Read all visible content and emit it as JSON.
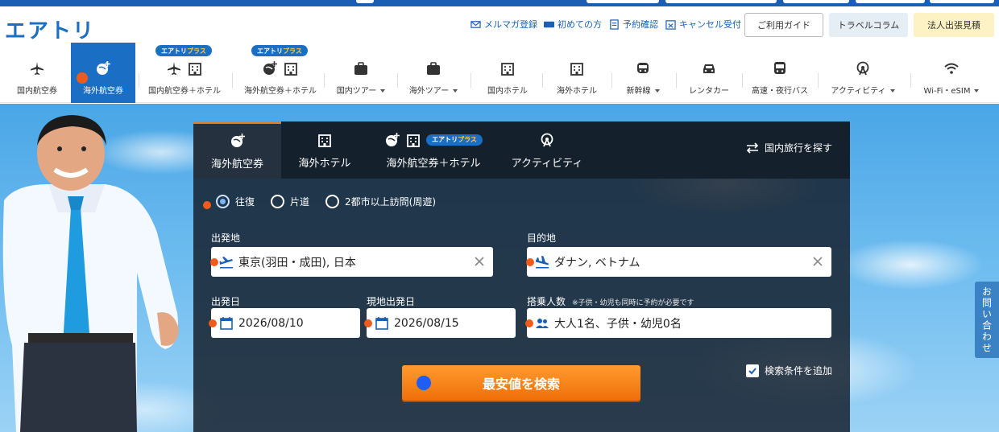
{
  "logo": "エアトリ",
  "header_links": [
    {
      "label": "メルマガ登録",
      "icon": "mail-icon"
    },
    {
      "label": "初めての方",
      "icon": "new-icon"
    },
    {
      "label": "予約確認",
      "icon": "document-icon"
    },
    {
      "label": "キャンセル受付",
      "icon": "cancel-calendar-icon"
    }
  ],
  "header_buttons": {
    "guide": "ご利用ガイド",
    "column": "トラベルコラム",
    "corporate": "法人出張見積"
  },
  "nav": {
    "items": [
      {
        "label": "国内航空券"
      },
      {
        "label": "海外航空券"
      },
      {
        "label": "国内航空券＋ホテル"
      },
      {
        "label": "海外航空券＋ホテル"
      },
      {
        "label": "国内ツアー"
      },
      {
        "label": "海外ツアー"
      },
      {
        "label": "国内ホテル"
      },
      {
        "label": "海外ホテル"
      },
      {
        "label": "新幹線"
      },
      {
        "label": "レンタカー"
      },
      {
        "label": "高速・夜行バス"
      },
      {
        "label": "アクティビティ"
      },
      {
        "label": "Wi-Fi・eSIM"
      }
    ],
    "badge_base": "エアトリ",
    "badge_plus": "プラス"
  },
  "search": {
    "tabs": [
      {
        "label": "海外航空券"
      },
      {
        "label": "海外ホテル"
      },
      {
        "label": "海外航空券＋ホテル"
      },
      {
        "label": "アクティビティ"
      }
    ],
    "domestic_link": "国内旅行を探す",
    "trip_types": [
      "往復",
      "片道",
      "2都市以上訪問(周遊)"
    ],
    "labels": {
      "origin": "出発地",
      "destination": "目的地",
      "depart_date": "出発日",
      "return_date": "現地出発日",
      "passengers": "搭乗人数",
      "passenger_note": "※子供・幼児も同時に予約が必要です"
    },
    "values": {
      "origin": "東京(羽田・成田), 日本",
      "destination": "ダナン, ベトナム",
      "depart_date": "2026/08/10",
      "return_date": "2026/08/15",
      "passengers": "大人1名、子供・幼児0名"
    },
    "submit": "最安値を検索",
    "add_conditions": "検索条件を追加"
  },
  "side_contact": "お問い合わせ",
  "colors": {
    "brand": "#1a6fc4",
    "accent": "#f06f0a",
    "marker": "#f05a1a",
    "panel": "#162230"
  }
}
